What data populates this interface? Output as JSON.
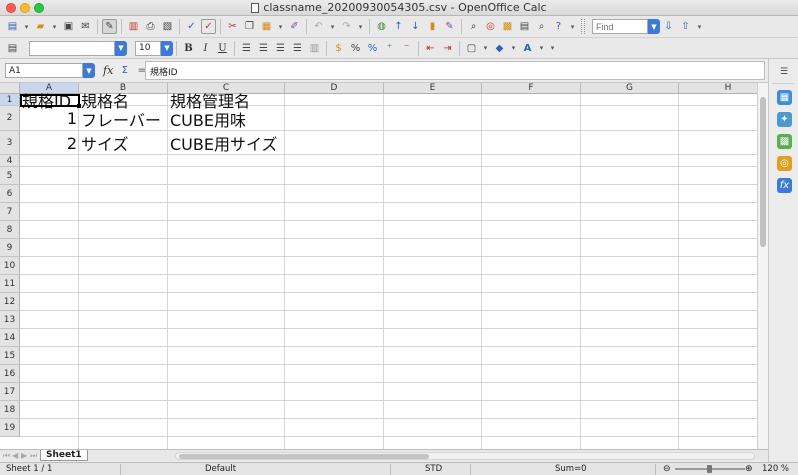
{
  "window": {
    "title": "classname_20200930054305.csv - OpenOffice Calc"
  },
  "toolbar": {
    "find_placeholder": "Find"
  },
  "format": {
    "font_name": "",
    "font_size": "10",
    "bold": "B",
    "italic": "I",
    "underline": "U",
    "percent": "%"
  },
  "formula_bar": {
    "cell_ref": "A1",
    "content": "規格ID",
    "equals": "="
  },
  "sheet": {
    "columns": [
      "A",
      "B",
      "C",
      "D",
      "E",
      "F",
      "G",
      "H"
    ],
    "rows": [
      "1",
      "2",
      "3",
      "4",
      "5",
      "6",
      "7",
      "8",
      "9",
      "10",
      "11",
      "12",
      "13",
      "14",
      "15",
      "16",
      "17",
      "18",
      "19"
    ],
    "cells": {
      "A1": "規格ID",
      "B1": "規格名",
      "C1": "規格管理名",
      "A2": "1",
      "B2": "フレーバー",
      "C2": "CUBE用味",
      "A3": "2",
      "B3": "サイズ",
      "C3": "CUBE用サイズ"
    },
    "tab": "Sheet1"
  },
  "status": {
    "sheet": "Sheet 1 / 1",
    "style": "Default",
    "mode": "STD",
    "sum": "Sum=0",
    "zoom": "120 %"
  },
  "colors": {
    "selected_header": "#c8d7ec",
    "accent_blue": "#3d7ad6"
  }
}
